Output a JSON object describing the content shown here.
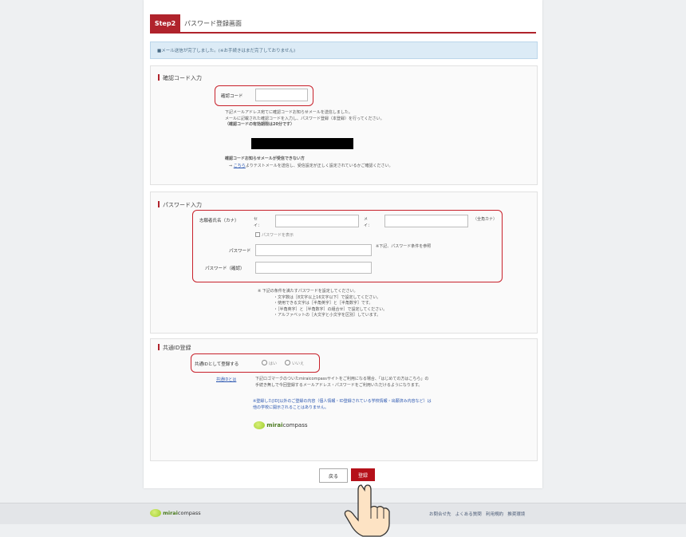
{
  "header": {
    "step_badge": "Step2",
    "step_title": "パスワード登録画面"
  },
  "notice": {
    "text": "■メール送信が完了しました。(※お手続きはまだ完了しておりません)"
  },
  "confirm_section": {
    "title": "確認コード入力",
    "code_label": "確認コード",
    "code_value": "",
    "desc1": "下記メールアドレス宛てに確認コードお知らせメールを送信しました。",
    "desc2": "メールに記載された確認コードを入力し、パスワード登録（本登録）を行ってください。",
    "desc3": "（確認コードの有効期限は20分です）",
    "not_received": "確認コードお知らせメールが受信できない方",
    "link_text": "こちら",
    "link_after": "よりテストメールを送信し、受信設定が正しく設定されているかご確認ください。"
  },
  "password_section": {
    "title": "パスワード入力",
    "name_label": "志願者氏名（カナ）",
    "sei_label": "セイ：",
    "mei_label": "メイ：",
    "kana_note": "（全角カナ）",
    "checkbox_label": "パスワードを表示",
    "password_label": "パスワード",
    "password_note": "※下記、パスワード条件を参照",
    "confirm_label": "パスワード（確認）",
    "rules": [
      "※ 下記の条件を満たすパスワードを設定してください。",
      "・文字数は［8文字以上16文字以下］で設定してください。",
      "・使用できる文字は［半角英字］と［半角数字］です。",
      "・［半角英字］と［半角数字］の組合せ］で設定してください。",
      "・アルファベットの［大文字と小文字を区別］しています。"
    ]
  },
  "shared_section": {
    "title": "共通ID登録",
    "register_label": "共通IDとして登録する",
    "yes": "はい",
    "no": "いいえ",
    "about_link": "共通IDとは",
    "about_text1": "下記ロゴマークのついたmiraicompassサイトをご利用になる場合、「はじめての方はこちら」の",
    "about_text2": "手続き無しで今回登録するメールアドレス・パスワードをご利用いただけるようになります。",
    "warning1": "※登録した[ID]以外のご登録の内容（個人情報・ID登録されている学校情報・出願済み内容など）は",
    "warning2": "他の学校に開示されることはありません。",
    "logo_bold": "mirai",
    "logo_rest": "compass"
  },
  "buttons": {
    "clear": "戻る",
    "submit": "登録"
  },
  "footer": {
    "logo_bold": "mirai",
    "logo_rest": "compass",
    "links": [
      "お問合せ先",
      "よくある質問",
      "利用規約",
      "推奨環境"
    ]
  },
  "colors": {
    "accent": "#b0232c",
    "highlight": "#c8212b",
    "notice_bg": "#dcebf6"
  }
}
